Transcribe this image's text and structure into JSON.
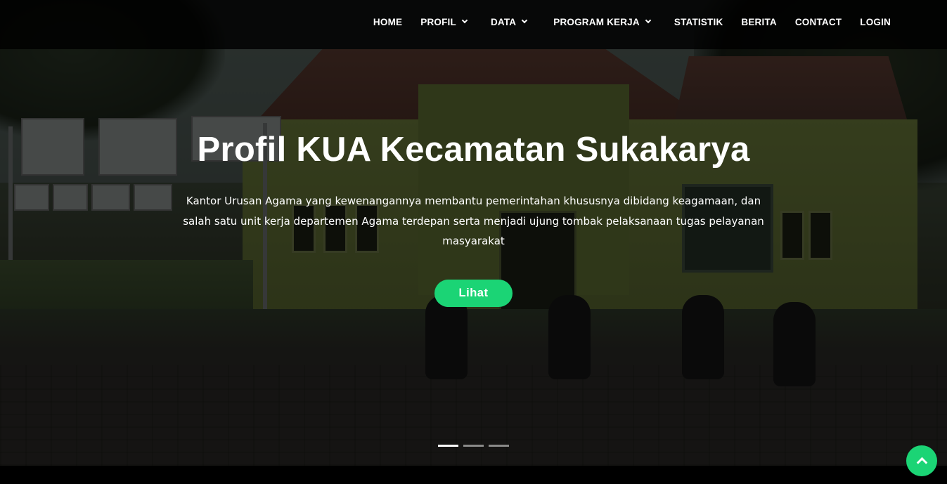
{
  "nav": {
    "items": [
      {
        "label": "HOME",
        "dropdown": false
      },
      {
        "label": "PROFIL",
        "dropdown": true
      },
      {
        "label": "DATA",
        "dropdown": true
      },
      {
        "label": "PROGRAM KERJA",
        "dropdown": true
      },
      {
        "label": "STATISTIK",
        "dropdown": false
      },
      {
        "label": "BERITA",
        "dropdown": false
      },
      {
        "label": "CONTACT",
        "dropdown": false
      },
      {
        "label": "LOGIN",
        "dropdown": false
      }
    ]
  },
  "hero": {
    "title": "Profil KUA Kecamatan Sukakarya",
    "description": "Kantor Urusan Agama yang kewenangannya membantu pemerintahan khususnya dibidang keagamaan, dan salah satu unit kerja departemen Agama terdepan serta menjadi ujung tombak pelaksanaan tugas pelayanan masyarakat",
    "button_label": "Lihat",
    "slides_total": 3,
    "active_slide": 1
  },
  "colors": {
    "accent": "#1bd475",
    "header_bg": "#0d0d0d"
  },
  "icons": {
    "dropdown": "chevron-down-icon",
    "back_to_top": "chevron-up-icon"
  }
}
